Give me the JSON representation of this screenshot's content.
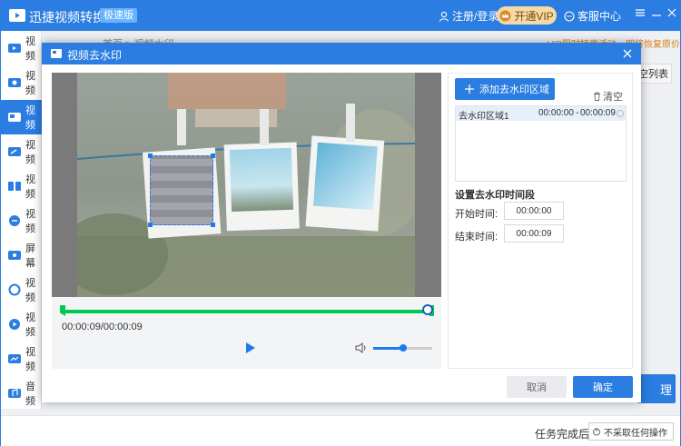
{
  "app": {
    "name": "迅捷视频转换器",
    "badge": "极速版",
    "login": "注册/登录",
    "vip": "开通VIP",
    "service": "客服中心"
  },
  "sidebar": {
    "items": [
      {
        "label": "视频"
      },
      {
        "label": "视频"
      },
      {
        "label": "视频"
      },
      {
        "label": "视频"
      },
      {
        "label": "视频"
      },
      {
        "label": "视频"
      },
      {
        "label": "屏幕"
      },
      {
        "label": "视频"
      },
      {
        "label": "视频"
      },
      {
        "label": "视频"
      },
      {
        "label": "音频"
      }
    ]
  },
  "background": {
    "breadcrumb": "首页 > 视频水印",
    "promo": "VIP限时特惠活动，即将恢复原价",
    "clear_list": "空列表",
    "process": "理"
  },
  "statusbar": {
    "label": "任务完成后",
    "select_value": "不采取任何操作"
  },
  "modal": {
    "title": "视频去水印",
    "time_readout": "00:00:09/00:00:09",
    "progress_fraction": 1.0,
    "volume_fraction": 0.5,
    "add_region": "添加去水印区域",
    "clear": "清空",
    "regions": [
      {
        "name": "去水印区域1",
        "start": "00:00:00",
        "sep": "-",
        "end": "00:00:09"
      }
    ],
    "section_title": "设置去水印时间段",
    "start_label": "开始时间:",
    "start_value": "00:00:00",
    "end_label": "结束时间:",
    "end_value": "00:00:09",
    "cancel": "取消",
    "ok": "确定"
  },
  "colors": {
    "accent": "#2b7de1",
    "timeline": "#00c853",
    "vip": "#f6d9a4"
  }
}
